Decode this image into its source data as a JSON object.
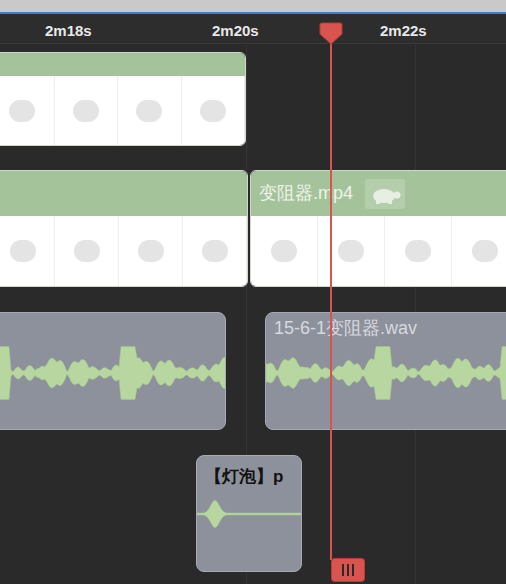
{
  "ruler": {
    "ticks": [
      "2m18s",
      "2m20s",
      "2m22s"
    ]
  },
  "tracks": [
    {
      "kind": "video",
      "clips": [
        {
          "retimed": false
        }
      ]
    },
    {
      "kind": "video",
      "clips": [
        {
          "retimed": false
        },
        {
          "name": "变阻器.mp4",
          "retimed": true
        }
      ]
    },
    {
      "kind": "audio",
      "clips": [
        {},
        {
          "name": "15-6-1变阻器.wav"
        }
      ]
    },
    {
      "kind": "effect",
      "clips": [
        {
          "name": "【灯泡】p"
        }
      ]
    }
  ]
}
